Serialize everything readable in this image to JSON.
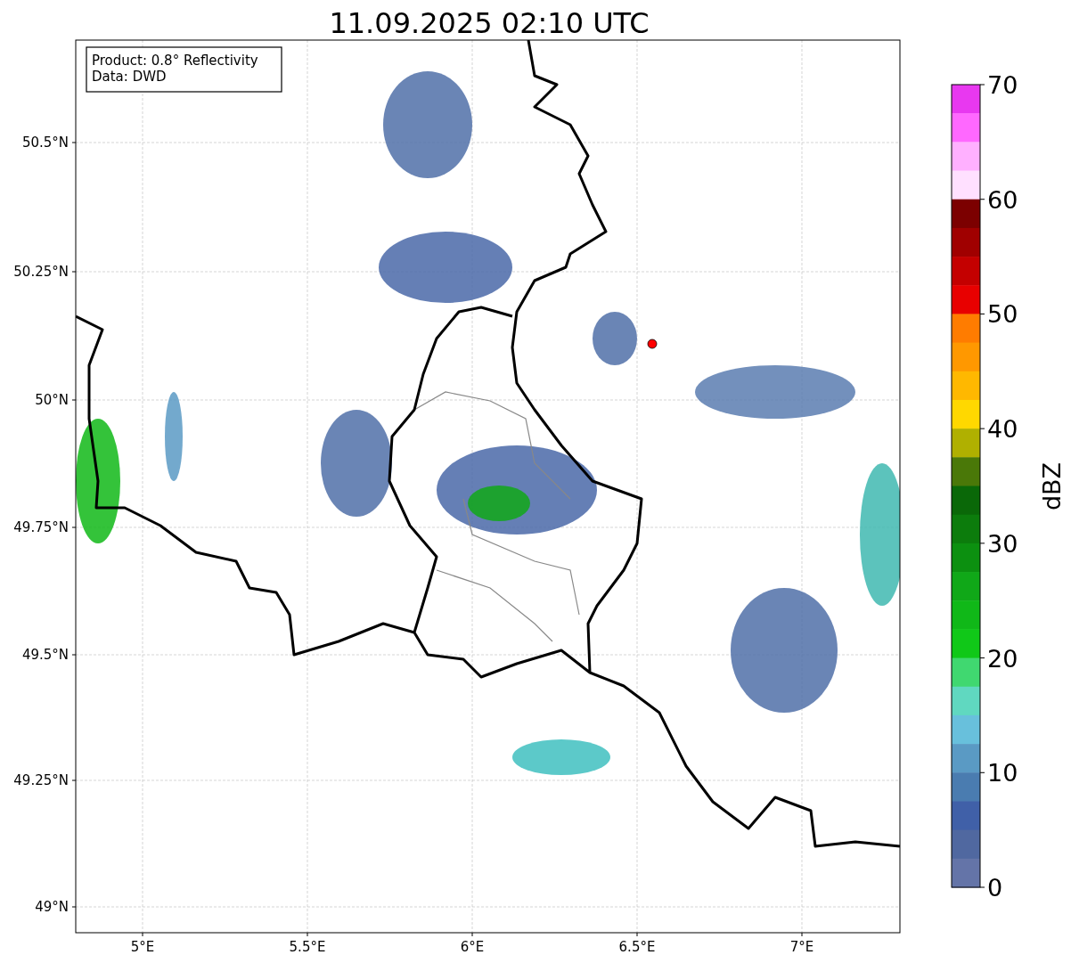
{
  "title": "11.09.2025 02:10 UTC",
  "annotation": [
    "Product: 0.8° Reflectivity",
    "Data: DWD"
  ],
  "y_ticks": [
    "50.5°N",
    "50.25°N",
    "50°N",
    "49.75°N",
    "49.5°N",
    "49.25°N",
    "49°N"
  ],
  "x_ticks": [
    "5°E",
    "5.5°E",
    "6°E",
    "6.5°E",
    "7°E"
  ],
  "colorbar": {
    "label": "dBZ",
    "tick_labels": [
      "70",
      "60",
      "50",
      "40",
      "30",
      "20",
      "10",
      "0"
    ],
    "segments": [
      {
        "color": "#e838f0"
      },
      {
        "color": "#ff68ff"
      },
      {
        "color": "#ffb0ff"
      },
      {
        "color": "#ffe0ff"
      },
      {
        "color": "#7c0000"
      },
      {
        "color": "#a00000"
      },
      {
        "color": "#c40000"
      },
      {
        "color": "#e80000"
      },
      {
        "color": "#ff7c00"
      },
      {
        "color": "#ff9800"
      },
      {
        "color": "#ffb800"
      },
      {
        "color": "#ffd800"
      },
      {
        "color": "#b0b000"
      },
      {
        "color": "#4a7808"
      },
      {
        "color": "#0a6808"
      },
      {
        "color": "#0c7c0c"
      },
      {
        "color": "#0c9010"
      },
      {
        "color": "#10a818"
      },
      {
        "color": "#10b818"
      },
      {
        "color": "#10c818"
      },
      {
        "color": "#40d870"
      },
      {
        "color": "#60d8c0"
      },
      {
        "color": "#68c0dc"
      },
      {
        "color": "#5a9ac4"
      },
      {
        "color": "#4a7cb0"
      },
      {
        "color": "#4060a8"
      },
      {
        "color": "#5068a0"
      },
      {
        "color": "#6474a8"
      }
    ]
  }
}
